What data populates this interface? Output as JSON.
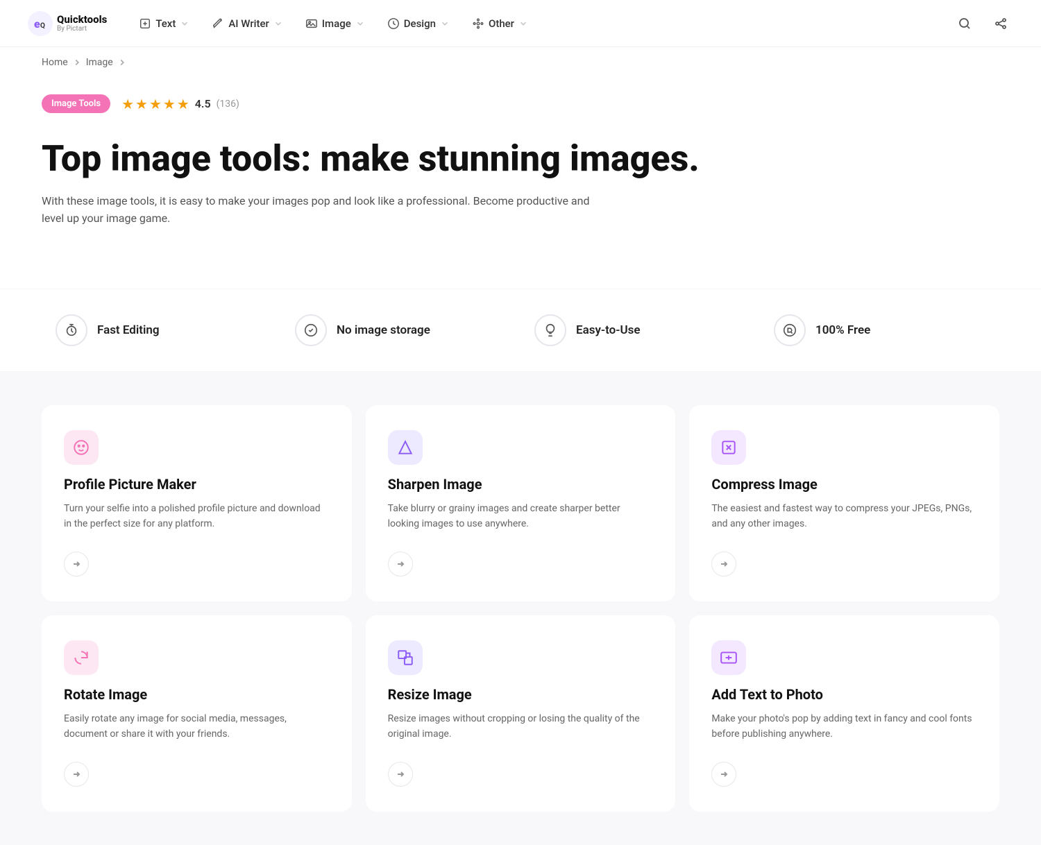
{
  "brand": {
    "name": "Quicktools",
    "subtitle": "By Pictart"
  },
  "nav": {
    "items": [
      {
        "id": "text",
        "label": "Text",
        "icon": "text-icon"
      },
      {
        "id": "ai-writer",
        "label": "AI Writer",
        "icon": "ai-writer-icon"
      },
      {
        "id": "image",
        "label": "Image",
        "icon": "image-icon"
      },
      {
        "id": "design",
        "label": "Design",
        "icon": "design-icon"
      },
      {
        "id": "other",
        "label": "Other",
        "icon": "other-icon"
      }
    ],
    "search_label": "Search",
    "share_label": "Share"
  },
  "breadcrumb": {
    "home": "Home",
    "current": "Image"
  },
  "hero": {
    "badge": "Image Tools",
    "rating": {
      "value": "4.5",
      "count": "(136)",
      "stars": 4.5
    },
    "title": "Top image tools: make stunning images.",
    "subtitle": "With these image tools, it is easy to make your images pop and look like a professional. Become productive and level up your image game."
  },
  "features": [
    {
      "id": "fast-editing",
      "label": "Fast Editing",
      "icon": "timer-icon"
    },
    {
      "id": "no-storage",
      "label": "No image storage",
      "icon": "check-circle-icon"
    },
    {
      "id": "easy-to-use",
      "label": "Easy-to-Use",
      "icon": "lightbulb-icon"
    },
    {
      "id": "free",
      "label": "100% Free",
      "icon": "free-icon"
    }
  ],
  "cards": [
    {
      "id": "profile-picture-maker",
      "icon": "face-icon",
      "icon_color": "pink",
      "title": "Profile Picture Maker",
      "description": "Turn your selfie into a polished profile picture and download in the perfect size for any platform."
    },
    {
      "id": "sharpen-image",
      "icon": "triangle-icon",
      "icon_color": "purple",
      "title": "Sharpen Image",
      "description": "Take blurry or grainy images and create sharper better looking images to use anywhere."
    },
    {
      "id": "compress-image",
      "icon": "compress-icon",
      "icon_color": "violet",
      "title": "Compress Image",
      "description": "The easiest and fastest way to compress your JPEGs, PNGs, and any other images."
    },
    {
      "id": "rotate-image",
      "icon": "rotate-icon",
      "icon_color": "pink",
      "title": "Rotate Image",
      "description": "Easily rotate any image for social media, messages, document or share it with your friends."
    },
    {
      "id": "resize-image",
      "icon": "resize-icon",
      "icon_color": "purple",
      "title": "Resize Image",
      "description": "Resize images without cropping or losing the quality of the original image."
    },
    {
      "id": "add-text-to-photo",
      "icon": "text-photo-icon",
      "icon_color": "violet",
      "title": "Add Text to Photo",
      "description": "Make your photo's pop by adding text in fancy and cool fonts before publishing anywhere."
    }
  ],
  "colors": {
    "accent": "#8b5cf6",
    "pink": "#f472b6",
    "star": "#f59e0b"
  }
}
